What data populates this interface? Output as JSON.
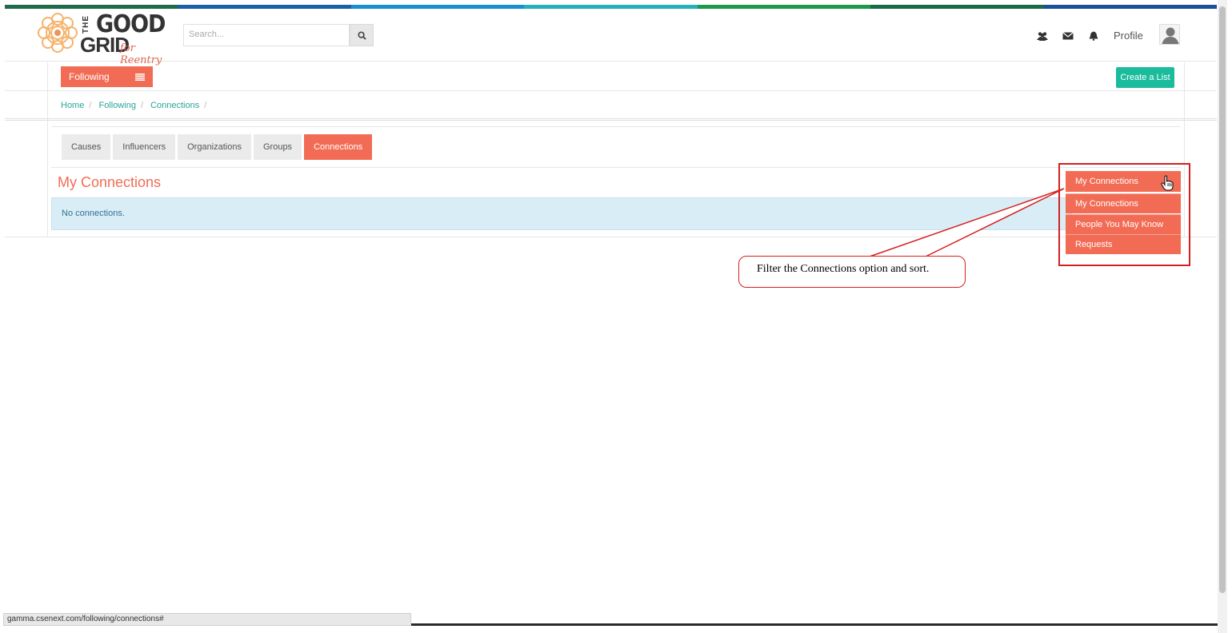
{
  "colors": {
    "brand_orange": "#f26c55",
    "teal": "#1abc9c",
    "alert_bg": "#d9edf7",
    "annotation_red": "#d42020",
    "top_bar": [
      "#1f6a4a",
      "#1b5fa8",
      "#1a8fd0",
      "#26b0b8",
      "#1a9a4a",
      "#1a6a4a",
      "#1b4f9a"
    ]
  },
  "header": {
    "logo": {
      "the": "THE",
      "good": "GOOD",
      "grid": "GRID",
      "tagline": "for Reentry",
      "icon": "flower-logo-icon"
    },
    "search": {
      "placeholder": "Search...",
      "icon": "search-icon"
    },
    "icons": [
      "users-icon",
      "envelope-icon",
      "bell-icon"
    ],
    "profile_label": "Profile",
    "avatar_icon": "user-avatar-icon"
  },
  "toolbar": {
    "following_label": "Following",
    "following_icon": "list-icon",
    "create_list_label": "Create a List"
  },
  "breadcrumb": [
    "Home",
    "Following",
    "Connections"
  ],
  "tabs": [
    {
      "label": "Causes",
      "active": false
    },
    {
      "label": "Influencers",
      "active": false
    },
    {
      "label": "Organizations",
      "active": false
    },
    {
      "label": "Groups",
      "active": false
    },
    {
      "label": "Connections",
      "active": true
    }
  ],
  "main": {
    "title": "My Connections",
    "empty_message": "No connections."
  },
  "filter_dropdown": {
    "selected": "My Connections",
    "options": [
      "My Connections",
      "People You May Know",
      "Requests"
    ],
    "cursor_icon": "hand-pointer-icon"
  },
  "annotation": {
    "text": "Filter the Connections option and sort."
  },
  "status_bar": {
    "url": "gamma.csenext.com/following/connections#"
  }
}
